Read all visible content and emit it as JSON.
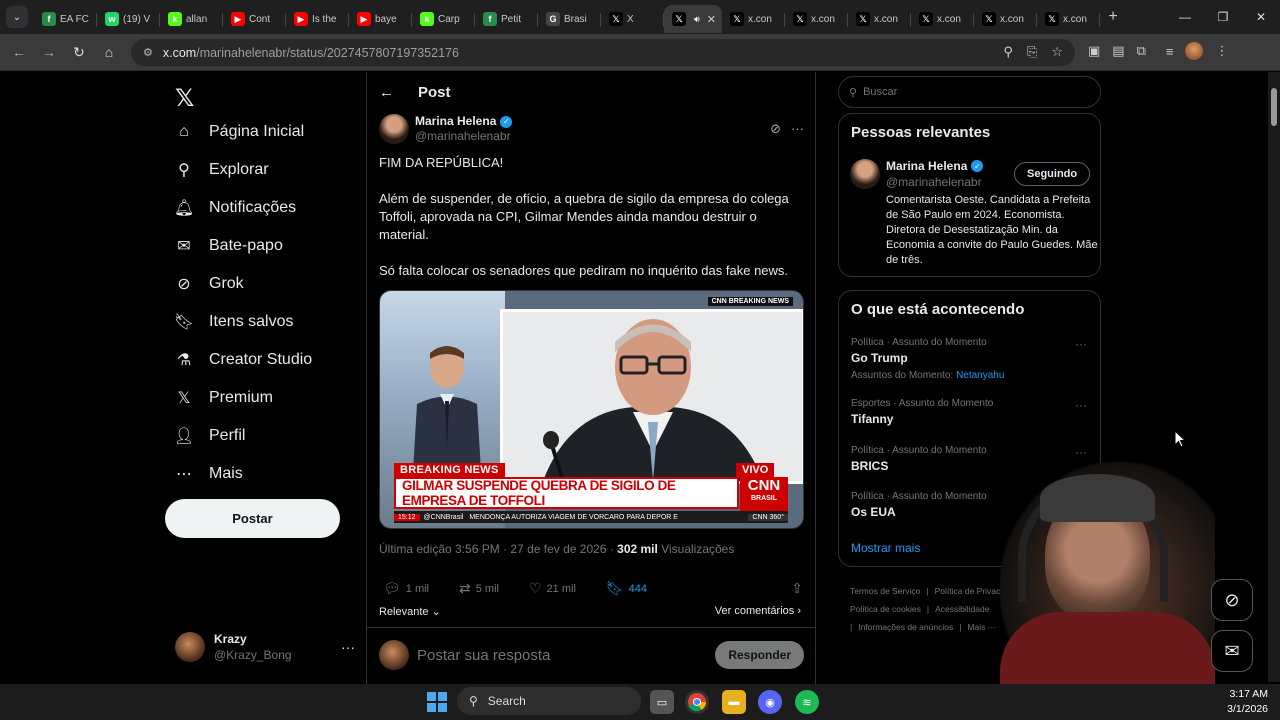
{
  "browser": {
    "tabs": [
      {
        "label": "EA FC",
        "fav": "f",
        "color": "#2a8a4a"
      },
      {
        "label": "(19) V",
        "fav": "w",
        "color": "#25d366"
      },
      {
        "label": "allan",
        "fav": "k",
        "color": "#53fc18"
      },
      {
        "label": "Cont",
        "fav": "▶",
        "color": "#ff0000"
      },
      {
        "label": "Is the",
        "fav": "▶",
        "color": "#ff0000"
      },
      {
        "label": "baye",
        "fav": "▶",
        "color": "#ff0000"
      },
      {
        "label": "Carp",
        "fav": "k",
        "color": "#53fc18"
      },
      {
        "label": "Petit",
        "fav": "f",
        "color": "#2a8a4a"
      },
      {
        "label": "Brasi",
        "fav": "G",
        "color": "#444"
      },
      {
        "label": "X",
        "fav": "𝕏",
        "color": "#000"
      },
      {
        "label": "",
        "fav": "𝕏",
        "color": "#000",
        "active": true
      },
      {
        "label": "x.con",
        "fav": "𝕏",
        "color": "#000"
      },
      {
        "label": "x.con",
        "fav": "𝕏",
        "color": "#000"
      },
      {
        "label": "x.con",
        "fav": "𝕏",
        "color": "#000"
      },
      {
        "label": "x.con",
        "fav": "𝕏",
        "color": "#000"
      },
      {
        "label": "x.con",
        "fav": "𝕏",
        "color": "#000"
      },
      {
        "label": "x.con",
        "fav": "𝕏",
        "color": "#000"
      }
    ],
    "url_host": "x.com",
    "url_path": "/marinahelenabr/status/2027457807197352176"
  },
  "nav": {
    "items": [
      {
        "label": "Página Inicial",
        "icon": "home-icon",
        "glyph": "⌂"
      },
      {
        "label": "Explorar",
        "icon": "search-icon",
        "glyph": "⚲"
      },
      {
        "label": "Notificações",
        "icon": "bell-icon",
        "glyph": "🔔︎"
      },
      {
        "label": "Bate-papo",
        "icon": "mail-icon",
        "glyph": "✉"
      },
      {
        "label": "Grok",
        "icon": "grok-icon",
        "glyph": "⊘"
      },
      {
        "label": "Itens salvos",
        "icon": "bookmark-icon",
        "glyph": "🔖︎"
      },
      {
        "label": "Creator Studio",
        "icon": "flask-icon",
        "glyph": "⚗"
      },
      {
        "label": "Premium",
        "icon": "x-logo-icon",
        "glyph": "𝕏"
      },
      {
        "label": "Perfil",
        "icon": "person-icon",
        "glyph": "👤︎"
      },
      {
        "label": "Mais",
        "icon": "more-circle-icon",
        "glyph": "⋯"
      }
    ],
    "post_label": "Postar",
    "me": {
      "name": "Krazy",
      "handle": "@Krazy_Bong"
    }
  },
  "post": {
    "header": "Post",
    "author": {
      "name": "Marina Helena",
      "handle": "@marinahelenabr"
    },
    "lines": [
      "FIM DA REPÚBLICA!",
      "Além de suspender, de ofício, a quebra de sigilo da empresa do colega Toffoli, aprovada na CPI, Gilmar Mendes ainda mandou destruir o material.",
      "Só falta colocar os senadores que pediram no inquérito das fake news."
    ],
    "media": {
      "top_tag": "CNN BREAKING NEWS",
      "breaking": "BREAKING NEWS",
      "vivo": "VIVO",
      "headline": "GILMAR SUSPENDE QUEBRA DE SIGILO DE EMPRESA DE TOFFOLI",
      "logo": "CNN",
      "logo_sub": "BRASIL",
      "time": "15:12",
      "channel": "@CNNBrasil",
      "ticker": "MENDONÇA AUTORIZA VIAGEM DE VORCARO PARA DEPOR E",
      "tag360": "CNN 360°"
    },
    "meta_edit": "Última edição 3:56 PM · 27 de fev de 2026 · ",
    "views_count": "302 mil",
    "views_label": "Visualizações",
    "replies": "1 mil",
    "reposts": "5 mil",
    "likes": "21 mil",
    "bookmarks": "444",
    "relevante": "Relevante",
    "ver_comentarios": "Ver comentários",
    "reply_placeholder": "Postar sua resposta",
    "reply_button": "Responder"
  },
  "right": {
    "search_placeholder": "Buscar",
    "relevant_title": "Pessoas relevantes",
    "relevant_user": {
      "name": "Marina Helena",
      "handle": "@marinahelenabr",
      "follow_label": "Seguindo",
      "bio": "Comentarista Oeste. Candidata a Prefeita de São Paulo em 2024. Economista. Diretora de Desestatização Min. da Economia a convite do Paulo Guedes. Mãe de três."
    },
    "trending_title": "O que está acontecendo",
    "trends": [
      {
        "context": "Política · Assunto do Momento",
        "topic": "Go Trump",
        "sub_label": "Assuntos do Momento: ",
        "sub_link": "Netanyahu"
      },
      {
        "context": "Esportes · Assunto do Momento",
        "topic": "Tifanny"
      },
      {
        "context": "Política · Assunto do Momento",
        "topic": "BRICS"
      },
      {
        "context": "Política · Assunto do Momento",
        "topic": "Os EUA"
      }
    ],
    "show_more": "Mostrar mais",
    "footer": [
      "Termos de Serviço",
      "|",
      "Política de Privacidade",
      "Política de cookies",
      "|",
      "Acessibilidade",
      "|",
      "Informações de anúncios",
      "|",
      "Mais ···"
    ]
  },
  "taskbar": {
    "search": "Search",
    "time": "3:17 AM",
    "date": "3/1/2026"
  },
  "colors": {
    "accent": "#1d9bf0",
    "bg": "#000000",
    "border": "#2f3336",
    "cnn_red": "#cc0000"
  }
}
